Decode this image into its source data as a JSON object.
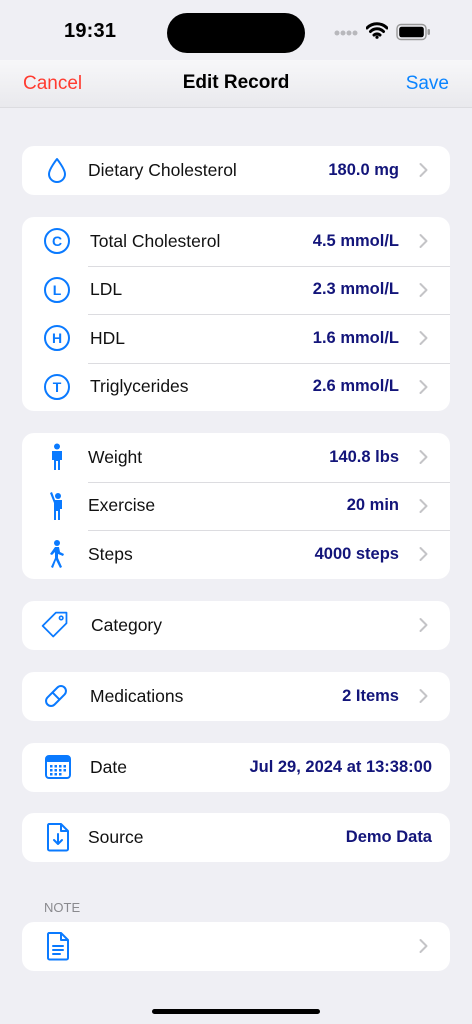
{
  "status_bar": {
    "time": "19:31"
  },
  "nav": {
    "cancel": "Cancel",
    "title": "Edit Record",
    "save": "Save"
  },
  "colors": {
    "accent": "#0a84ff",
    "destructive": "#ff3b30",
    "value": "#13157a",
    "icon": "#0a7aff"
  },
  "dietary": {
    "label": "Dietary Cholesterol",
    "value": "180.0 mg",
    "icon": "drop-icon"
  },
  "lipids": [
    {
      "label": "Total Cholesterol",
      "value": "4.5 mmol/L",
      "letter": "C"
    },
    {
      "label": "LDL",
      "value": "2.3 mmol/L",
      "letter": "L"
    },
    {
      "label": "HDL",
      "value": "1.6 mmol/L",
      "letter": "H"
    },
    {
      "label": "Triglycerides",
      "value": "2.6 mmol/L",
      "letter": "T"
    }
  ],
  "activity": [
    {
      "label": "Weight",
      "value": "140.8 lbs",
      "icon": "person-standing-icon"
    },
    {
      "label": "Exercise",
      "value": "20 min",
      "icon": "person-waving-icon"
    },
    {
      "label": "Steps",
      "value": "4000 steps",
      "icon": "person-walking-icon"
    }
  ],
  "category": {
    "label": "Category",
    "icon": "tag-icon"
  },
  "medications": {
    "label": "Medications",
    "value": "2 Items",
    "icon": "pill-icon"
  },
  "date": {
    "label": "Date",
    "value": "Jul 29, 2024 at 13:38:00",
    "icon": "calendar-icon"
  },
  "source": {
    "label": "Source",
    "value": "Demo Data",
    "icon": "document-download-icon"
  },
  "note": {
    "header": "NOTE",
    "icon": "document-text-icon"
  }
}
